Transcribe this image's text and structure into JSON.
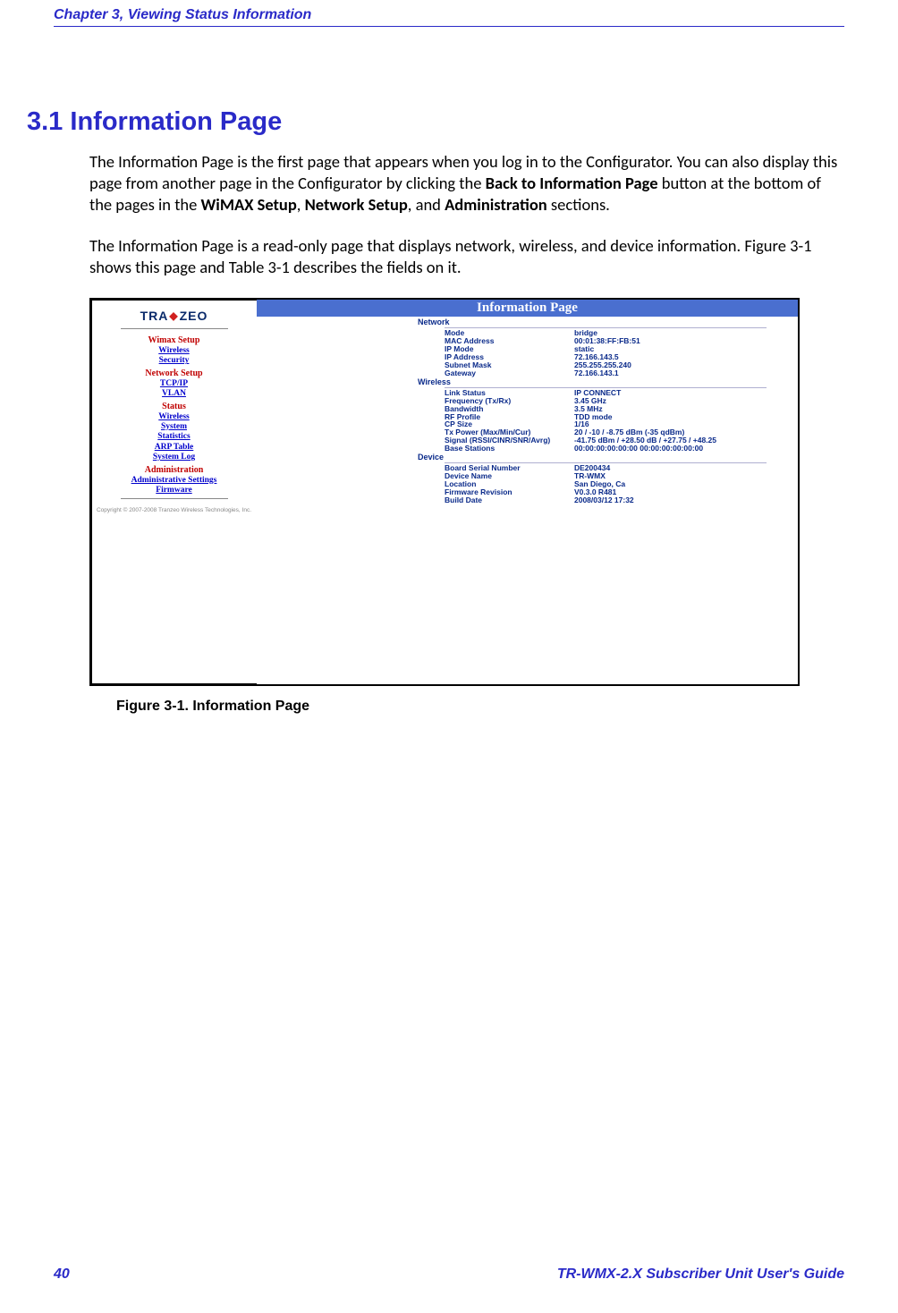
{
  "header": {
    "chapter": "Chapter 3, Viewing Status Information"
  },
  "section": {
    "number": "3.1",
    "title": "Information Page"
  },
  "para1": {
    "t1": "The Information Page is the first page that appears when you log in to the Configurator. You can also display this page from another page in the Configurator by clicking the ",
    "b1": "Back to Information Page",
    "t2": " button at the bottom of the pages in the ",
    "b2": "WiMAX Setup",
    "t3": ", ",
    "b3": "Network Setup",
    "t4": ", and ",
    "b4": "Administration",
    "t5": " sections."
  },
  "para2": "The Information Page is a read-only page that displays network, wireless, and device information. Figure 3-1 shows this page and Table 3-1 describes the fields on it.",
  "figure": {
    "sidebar": {
      "logo_left": "TRA",
      "logo_right": "ZEO",
      "groups": [
        {
          "hdr": "Wimax Setup",
          "links": [
            "Wireless",
            "Security"
          ]
        },
        {
          "hdr": "Network Setup",
          "links": [
            "TCP/IP",
            "VLAN"
          ]
        },
        {
          "hdr": "Status",
          "links": [
            "Wireless",
            "System",
            "Statistics",
            "ARP Table",
            "System Log"
          ]
        },
        {
          "hdr": "Administration",
          "links": [
            "Administrative Settings",
            "Firmware"
          ]
        }
      ],
      "copyright": "Copyright © 2007-2008 Tranzeo Wireless Technologies, Inc."
    },
    "main": {
      "title": "Information Page",
      "sections": [
        {
          "name": "Network",
          "rows": [
            {
              "k": "Mode",
              "v": "bridge"
            },
            {
              "k": "MAC Address",
              "v": "00:01:38:FF:FB:51"
            },
            {
              "k": "IP Mode",
              "v": "static"
            },
            {
              "k": "IP Address",
              "v": "72.166.143.5"
            },
            {
              "k": "Subnet Mask",
              "v": "255.255.255.240"
            },
            {
              "k": "Gateway",
              "v": "72.166.143.1"
            }
          ]
        },
        {
          "name": "Wireless",
          "rows": [
            {
              "k": "Link Status",
              "v": "IP CONNECT"
            },
            {
              "k": "Frequency (Tx/Rx)",
              "v": "3.45 GHz"
            },
            {
              "k": "Bandwidth",
              "v": "3.5 MHz"
            },
            {
              "k": "RF Profile",
              "v": "TDD mode"
            },
            {
              "k": "CP Size",
              "v": "1/16"
            },
            {
              "k": "Tx Power (Max/Min/Cur)",
              "v": "20 / -10 / -8.75 dBm (-35 qdBm)"
            },
            {
              "k": "Signal (RSSI/CINR/SNR/Avrg)",
              "v": "-41.75 dBm / +28.50 dB / +27.75 / +48.25"
            },
            {
              "k": "Base Stations",
              "v": "00:00:00:00:00:00 00:00:00:00:00:00"
            }
          ]
        },
        {
          "name": "Device",
          "rows": [
            {
              "k": "Board Serial Number",
              "v": "DE200434"
            },
            {
              "k": "Device Name",
              "v": "TR-WMX"
            },
            {
              "k": "Location",
              "v": "San Diego, Ca"
            },
            {
              "k": "Firmware Revision",
              "v": "V0.3.0 R481"
            },
            {
              "k": "Build Date",
              "v": "2008/03/12 17:32"
            }
          ]
        }
      ]
    }
  },
  "caption": "Figure 3-1. Information Page",
  "footer": {
    "page": "40",
    "guide": "TR-WMX-2.X Subscriber Unit  User's Guide"
  }
}
